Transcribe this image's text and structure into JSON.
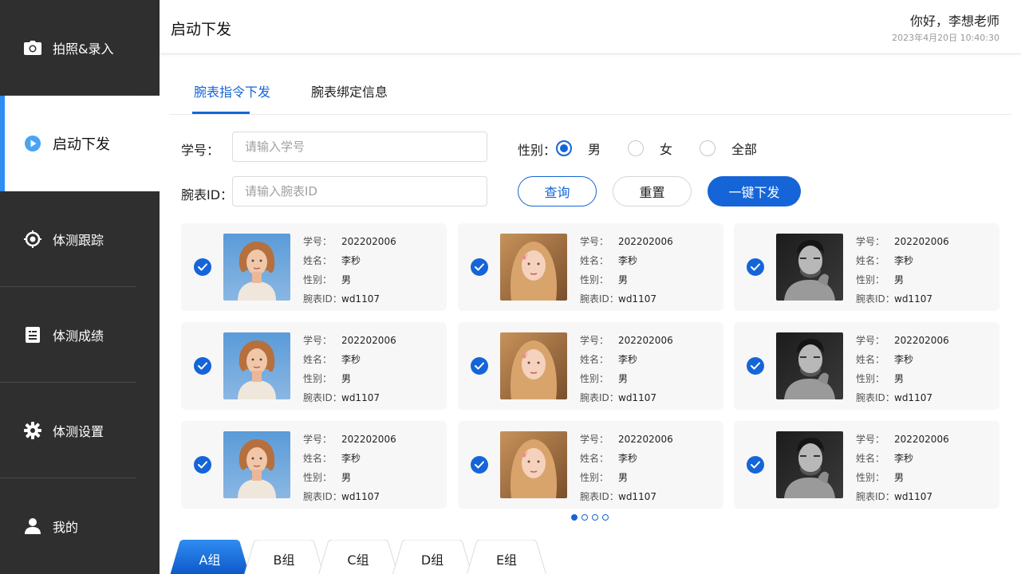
{
  "sidebar": {
    "items": [
      {
        "label": "拍照&录入",
        "icon": "camera-icon"
      },
      {
        "label": "启动下发",
        "icon": "play-circle-icon",
        "active": true
      },
      {
        "label": "体测跟踪",
        "icon": "target-icon"
      },
      {
        "label": "体测成绩",
        "icon": "report-icon"
      },
      {
        "label": "体测设置",
        "icon": "gear-icon"
      },
      {
        "label": "我的",
        "icon": "user-icon"
      }
    ]
  },
  "header": {
    "title": "启动下发",
    "greeting": "你好，李想老师",
    "datetime": "2023年4月20日 10:40:30"
  },
  "tabs": [
    {
      "label": "腕表指令下发",
      "active": true
    },
    {
      "label": "腕表绑定信息",
      "active": false
    }
  ],
  "filters": {
    "student_id_label": "学号：",
    "student_id_placeholder": "请输入学号",
    "watch_id_label": "腕表ID：",
    "watch_id_placeholder": "请输入腕表ID",
    "gender_label": "性别：",
    "gender_options": [
      {
        "label": "男",
        "checked": true
      },
      {
        "label": "女",
        "checked": false
      },
      {
        "label": "全部",
        "checked": false
      }
    ],
    "query_button": "查询",
    "reset_button": "重置",
    "send_button": "一键下发"
  },
  "card_labels": {
    "id": "学号：",
    "name": "姓名：",
    "gender": "性别：",
    "watch": "腕表ID："
  },
  "cards": [
    {
      "id": "202202006",
      "name": "李秒",
      "gender": "男",
      "watch": "wd1107",
      "photo": "portrait-girl-blue",
      "checked": true
    },
    {
      "id": "202202006",
      "name": "李秒",
      "gender": "男",
      "watch": "wd1107",
      "photo": "portrait-girl-warm",
      "checked": true
    },
    {
      "id": "202202006",
      "name": "李秒",
      "gender": "男",
      "watch": "wd1107",
      "photo": "portrait-man-bw",
      "checked": true
    },
    {
      "id": "202202006",
      "name": "李秒",
      "gender": "男",
      "watch": "wd1107",
      "photo": "portrait-girl-blue",
      "checked": true
    },
    {
      "id": "202202006",
      "name": "李秒",
      "gender": "男",
      "watch": "wd1107",
      "photo": "portrait-girl-warm",
      "checked": true
    },
    {
      "id": "202202006",
      "name": "李秒",
      "gender": "男",
      "watch": "wd1107",
      "photo": "portrait-man-bw",
      "checked": true
    },
    {
      "id": "202202006",
      "name": "李秒",
      "gender": "男",
      "watch": "wd1107",
      "photo": "portrait-girl-blue",
      "checked": true
    },
    {
      "id": "202202006",
      "name": "李秒",
      "gender": "男",
      "watch": "wd1107",
      "photo": "portrait-girl-warm",
      "checked": true
    },
    {
      "id": "202202006",
      "name": "李秒",
      "gender": "男",
      "watch": "wd1107",
      "photo": "portrait-man-bw",
      "checked": true
    }
  ],
  "pager": {
    "total": 4,
    "current": 1
  },
  "groups": [
    {
      "label": "A组",
      "active": true
    },
    {
      "label": "B组",
      "active": false
    },
    {
      "label": "C组",
      "active": false
    },
    {
      "label": "D组",
      "active": false
    },
    {
      "label": "E组",
      "active": false
    }
  ],
  "colors": {
    "accent": "#1565d8",
    "sidebar_bg": "#2f2f2f",
    "active_bar": "#2f8cf0"
  }
}
